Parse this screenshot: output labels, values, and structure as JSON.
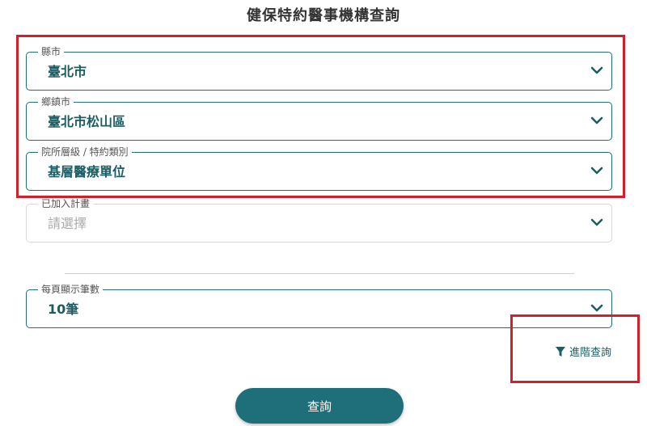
{
  "page": {
    "title": "健保特約醫事機構查詢"
  },
  "fields": [
    {
      "label": "縣市",
      "value": "臺北市"
    },
    {
      "label": "鄉鎮市",
      "value": "臺北市松山區"
    },
    {
      "label": "院所層級 / 特約類別",
      "value": "基層醫療單位"
    },
    {
      "label": "已加入計畫",
      "placeholder": "請選擇"
    }
  ],
  "page_size": {
    "label": "每頁顯示筆數",
    "value": "10筆"
  },
  "advanced": {
    "label": "進階查詢",
    "icon": "filter-icon"
  },
  "submit": {
    "label": "查詢"
  },
  "colors": {
    "accent": "#1f6f7a",
    "highlight": "#d0202c",
    "text": "#1a5d63"
  }
}
